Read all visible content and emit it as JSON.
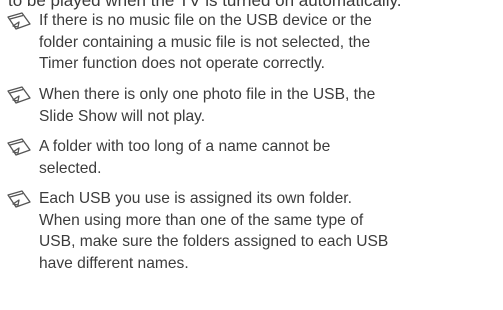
{
  "top_line": "to be played when the TV is turned on automatically.",
  "notes": [
    {
      "icon": "note-pencil-icon",
      "lines": [
        "If there is no music file on the USB device or the",
        "folder containing a music file is not selected, the",
        "Timer function does not operate correctly."
      ]
    },
    {
      "icon": "note-pencil-icon",
      "lines": [
        "When there is only one photo file in the USB, the",
        "Slide Show will not play."
      ]
    },
    {
      "icon": "note-pencil-icon",
      "lines": [
        "A folder with too long of a name cannot be",
        "selected."
      ]
    },
    {
      "icon": "note-pencil-icon",
      "lines": [
        "Each USB you use is assigned its own folder.",
        "When using more than one of the same type of",
        "USB, make sure the folders assigned to each USB",
        "have different names."
      ]
    }
  ]
}
